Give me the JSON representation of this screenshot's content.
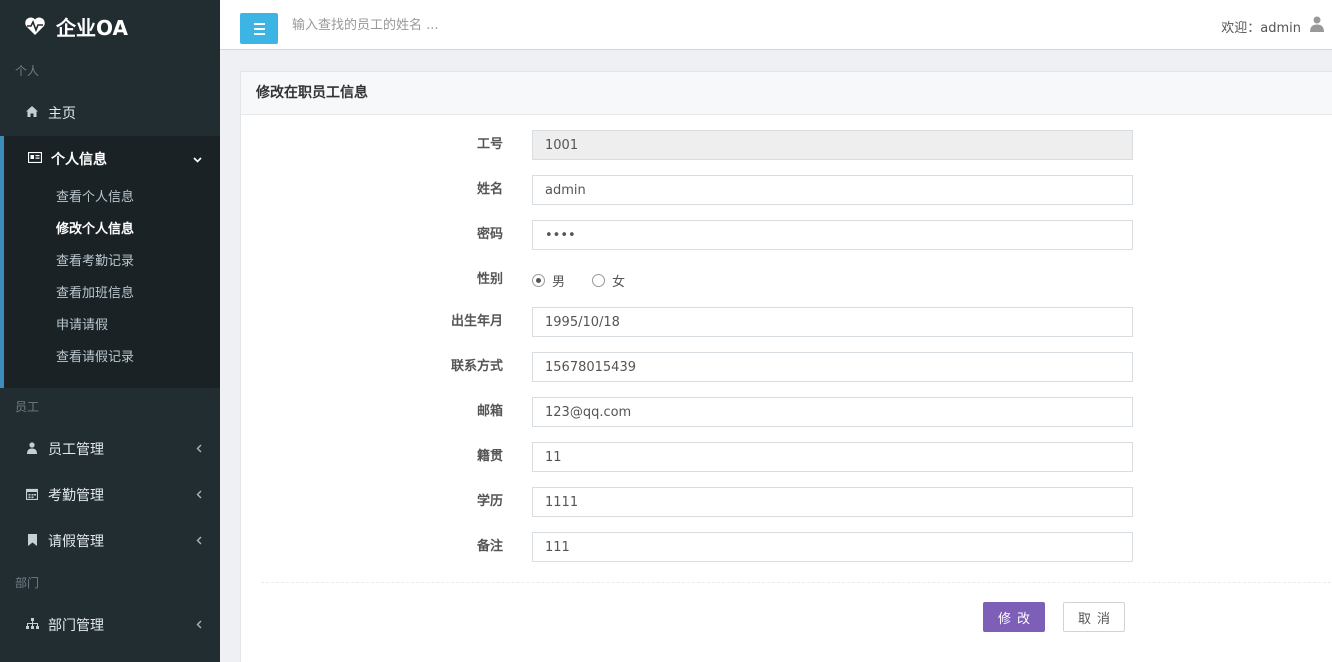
{
  "app": {
    "name": "企业OA"
  },
  "sidebar": {
    "sections": {
      "personal": "个人",
      "staff": "员工",
      "dept": "部门"
    },
    "home": {
      "label": "主页",
      "icon": "home-icon"
    },
    "personal_info": {
      "label": "个人信息",
      "icon": "id-card-icon",
      "children": [
        {
          "label": "查看个人信息"
        },
        {
          "label": "修改个人信息"
        },
        {
          "label": "查看考勤记录"
        },
        {
          "label": "查看加班信息"
        },
        {
          "label": "申请请假"
        },
        {
          "label": "查看请假记录"
        }
      ]
    },
    "staff_mgmt": {
      "label": "员工管理",
      "icon": "user-icon"
    },
    "attendance_mgmt": {
      "label": "考勤管理",
      "icon": "calendar-icon"
    },
    "leave_mgmt": {
      "label": "请假管理",
      "icon": "bookmark-icon"
    },
    "dept_mgmt": {
      "label": "部门管理",
      "icon": "sitemap-icon"
    }
  },
  "header": {
    "search_placeholder": "输入查找的员工的姓名 ...",
    "welcome": "欢迎：admin"
  },
  "panel": {
    "title": "修改在职员工信息",
    "fields": {
      "id": {
        "label": "工号",
        "value": "1001"
      },
      "name": {
        "label": "姓名",
        "value": "admin"
      },
      "password": {
        "label": "密码",
        "value": "••••"
      },
      "gender": {
        "label": "性别",
        "options": [
          "男",
          "女"
        ],
        "selected": "男"
      },
      "birth": {
        "label": "出生年月",
        "value": "1995/10/18"
      },
      "phone": {
        "label": "联系方式",
        "value": "15678015439"
      },
      "email": {
        "label": "邮箱",
        "value": "123@qq.com"
      },
      "origin": {
        "label": "籍贯",
        "value": "11"
      },
      "education": {
        "label": "学历",
        "value": "1111"
      },
      "remark": {
        "label": "备注",
        "value": "111"
      }
    },
    "save_label": "修改",
    "cancel_label": "取消"
  },
  "colors": {
    "sidebar_bg": "#222d32",
    "accent": "#3c8dbc",
    "toggle": "#3cb5e4",
    "save_button": "#7e5fb8"
  }
}
